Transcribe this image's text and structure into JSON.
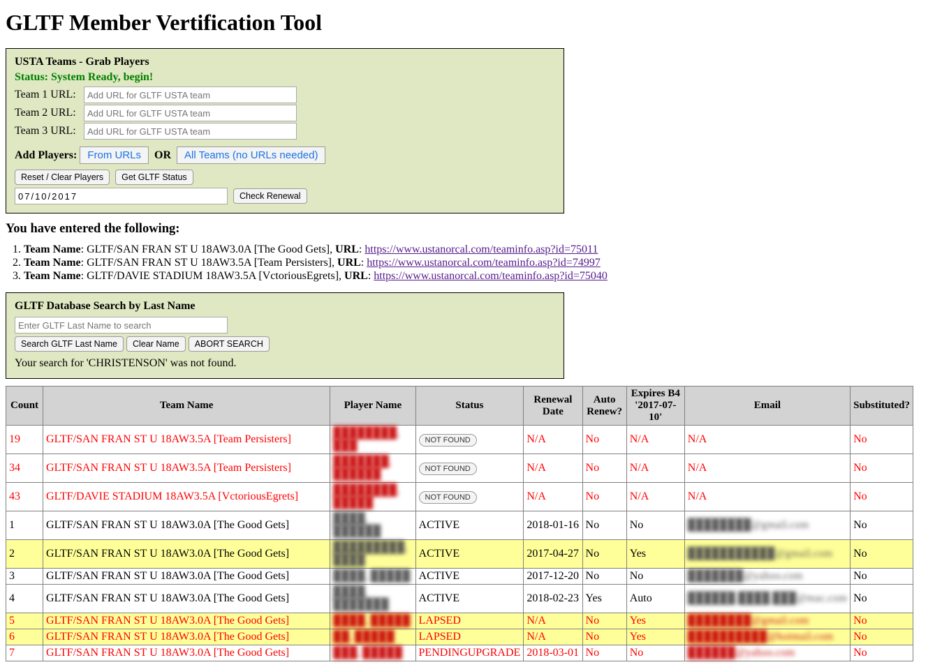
{
  "page_title": "GLTF Member Vertification Tool",
  "grab_panel": {
    "title": "USTA Teams - Grab Players",
    "status": "Status: System Ready, begin!",
    "team1_label": "Team 1 URL:",
    "team2_label": "Team 2 URL:",
    "team3_label": "Team 3 URL:",
    "url_placeholder": "Add URL for GLTF USTA team",
    "add_players_label": "Add Players:",
    "from_urls_btn": "From URLs",
    "or_text": "OR",
    "all_teams_btn": "All Teams (no URLs needed)",
    "reset_btn": "Reset / Clear Players",
    "get_status_btn": "Get GLTF Status",
    "date_value": "07/10/2017",
    "check_renewal_btn": "Check Renewal"
  },
  "entered_heading": "You have entered the following:",
  "entered_teams": [
    {
      "idx": "1.",
      "name_label": "Team Name",
      "name": "GLTF/SAN FRAN ST U 18AW3.0A [The Good Gets]",
      "url_label": "URL",
      "url": "https://www.ustanorcal.com/teaminfo.asp?id=75011"
    },
    {
      "idx": "2.",
      "name_label": "Team Name",
      "name": "GLTF/SAN FRAN ST U 18AW3.5A [Team Persisters]",
      "url_label": "URL",
      "url": "https://www.ustanorcal.com/teaminfo.asp?id=74997"
    },
    {
      "idx": "3.",
      "name_label": "Team Name",
      "name": "GLTF/DAVIE STADIUM 18AW3.5A [VctoriousEgrets]",
      "url_label": "URL",
      "url": "https://www.ustanorcal.com/teaminfo.asp?id=75040"
    }
  ],
  "search_panel": {
    "title": "GLTF Database Search by Last Name",
    "placeholder": "Enter GLTF Last Name to search",
    "search_btn": "Search GLTF Last Name",
    "clear_btn": "Clear Name",
    "abort_btn": "ABORT SEARCH",
    "result_msg": "Your search for 'CHRISTENSON' was not found."
  },
  "table": {
    "headers": {
      "count": "Count",
      "team": "Team Name",
      "player": "Player Name",
      "status": "Status",
      "renewal": "Renewal Date",
      "auto": "Auto Renew?",
      "expires": "Expires B4 '2017-07-10'",
      "email": "Email",
      "sub": "Substituted?"
    },
    "notfound_label": "NOT FOUND",
    "rows": [
      {
        "count": "19",
        "team": "GLTF/SAN FRAN ST U 18AW3.5A [Team Persisters]",
        "player": "████████, ███",
        "status_btn": true,
        "status": "",
        "renewal": "N/A",
        "auto": "No",
        "expires": "N/A",
        "email": "N/A",
        "sub": "No",
        "class": "red"
      },
      {
        "count": "34",
        "team": "GLTF/SAN FRAN ST U 18AW3.5A [Team Persisters]",
        "player": "███████, ██████",
        "status_btn": true,
        "status": "",
        "renewal": "N/A",
        "auto": "No",
        "expires": "N/A",
        "email": "N/A",
        "sub": "No",
        "class": "red"
      },
      {
        "count": "43",
        "team": "GLTF/DAVIE STADIUM 18AW3.5A [VctoriousEgrets]",
        "player": "████████, █████",
        "status_btn": true,
        "status": "",
        "renewal": "N/A",
        "auto": "No",
        "expires": "N/A",
        "email": "N/A",
        "sub": "No",
        "class": "red"
      },
      {
        "count": "1",
        "team": "GLTF/SAN FRAN ST U 18AW3.0A [The Good Gets]",
        "player": "████, ██████",
        "status_btn": false,
        "status": "ACTIVE",
        "renewal": "2018-01-16",
        "auto": "No",
        "expires": "No",
        "email": "████████@gmail.com",
        "sub": "No",
        "class": ""
      },
      {
        "count": "2",
        "team": "GLTF/SAN FRAN ST U 18AW3.0A [The Good Gets]",
        "player": "█████████, ████",
        "status_btn": false,
        "status": "ACTIVE",
        "renewal": "2017-04-27",
        "auto": "No",
        "expires": "Yes",
        "email": "███████████@gmail.com",
        "sub": "No",
        "class": "yellow"
      },
      {
        "count": "3",
        "team": "GLTF/SAN FRAN ST U 18AW3.0A [The Good Gets]",
        "player": "████, █████",
        "status_btn": false,
        "status": "ACTIVE",
        "renewal": "2017-12-20",
        "auto": "No",
        "expires": "No",
        "email": "███████@yahoo.com",
        "sub": "No",
        "class": ""
      },
      {
        "count": "4",
        "team": "GLTF/SAN FRAN ST U 18AW3.0A [The Good Gets]",
        "player": "████, ███████",
        "status_btn": false,
        "status": "ACTIVE",
        "renewal": "2018-02-23",
        "auto": "Yes",
        "expires": "Auto",
        "email": "██████.████.███@mac.com",
        "sub": "No",
        "class": ""
      },
      {
        "count": "5",
        "team": "GLTF/SAN FRAN ST U 18AW3.0A [The Good Gets]",
        "player": "████, █████",
        "status_btn": false,
        "status": "LAPSED",
        "renewal": "N/A",
        "auto": "No",
        "expires": "Yes",
        "email": "████████@gmail.com",
        "sub": "No",
        "class": "yellow red"
      },
      {
        "count": "6",
        "team": "GLTF/SAN FRAN ST U 18AW3.0A [The Good Gets]",
        "player": "██, █████",
        "status_btn": false,
        "status": "LAPSED",
        "renewal": "N/A",
        "auto": "No",
        "expires": "Yes",
        "email": "██████████@hotmail.com",
        "sub": "No",
        "class": "yellow red"
      },
      {
        "count": "7",
        "team": "GLTF/SAN FRAN ST U 18AW3.0A [The Good Gets]",
        "player": "███, █████",
        "status_btn": false,
        "status": "PENDINGUPGRADE",
        "renewal": "2018-03-01",
        "auto": "No",
        "expires": "No",
        "email": "██████@yahoo.com",
        "sub": "No",
        "class": "red"
      }
    ]
  }
}
